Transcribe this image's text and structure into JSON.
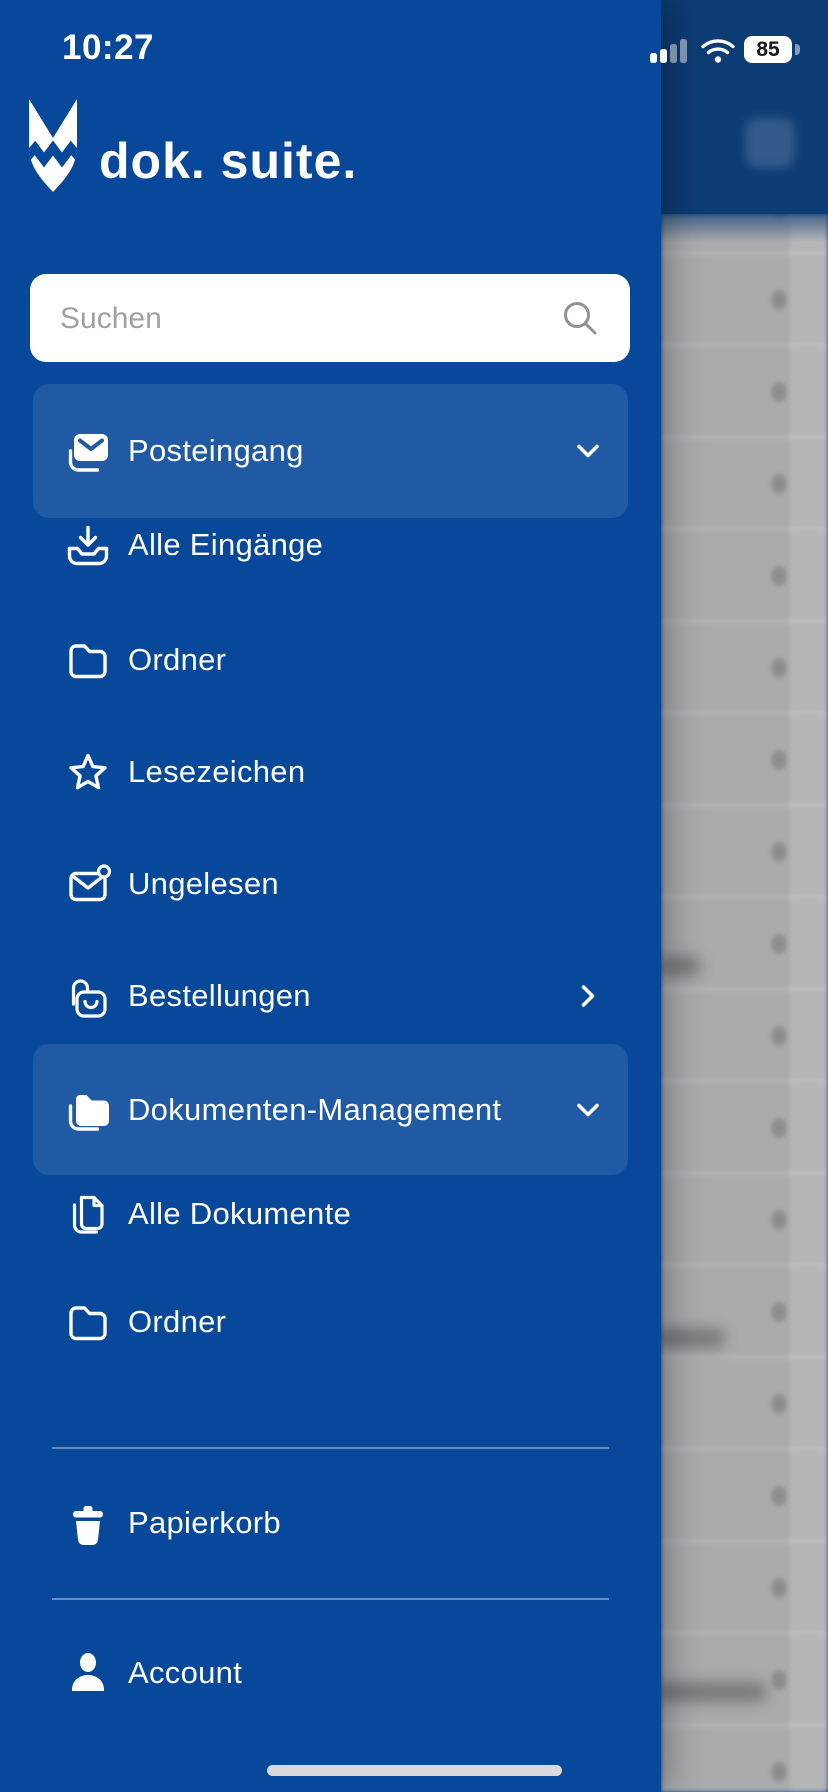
{
  "status_bar": {
    "time": "10:27",
    "battery_percent": "85",
    "signal_icon": "cellular-signal-2-of-4-bars",
    "wifi_icon": "wifi-full"
  },
  "app": {
    "logo_icon": "fox-logo",
    "title": "dok. suite."
  },
  "search": {
    "placeholder": "Suchen",
    "icon": "search-icon"
  },
  "menu": {
    "items": [
      {
        "label": "Posteingang",
        "icon": "inbox-envelope",
        "chevron": "down",
        "highlighted": true
      },
      {
        "label": "Alle Eingänge",
        "icon": "inbox-download"
      },
      {
        "label": "Ordner",
        "icon": "folder-outline"
      },
      {
        "label": "Lesezeichen",
        "icon": "star-outline"
      },
      {
        "label": "Ungelesen",
        "icon": "envelope-unread"
      },
      {
        "label": "Bestellungen",
        "icon": "orders-bag-lock",
        "chevron": "right"
      },
      {
        "label": "Dokumenten-Management",
        "icon": "folder-filled",
        "chevron": "down",
        "highlighted": true
      },
      {
        "label": "Alle Dokumente",
        "icon": "documents-copy"
      },
      {
        "label": "Ordner",
        "icon": "folder-outline"
      }
    ],
    "footer_items": [
      {
        "label": "Papierkorb",
        "icon": "trash"
      },
      {
        "label": "Account",
        "icon": "person"
      }
    ]
  },
  "colors": {
    "drawer_blue": "#07489B",
    "highlight_row": "rgba(255,255,255,0.10)",
    "background_header_navy": "#0d3b74",
    "background_gray": "#a9abac",
    "text_white": "#ffffff",
    "placeholder_gray": "#9ea0a2"
  }
}
